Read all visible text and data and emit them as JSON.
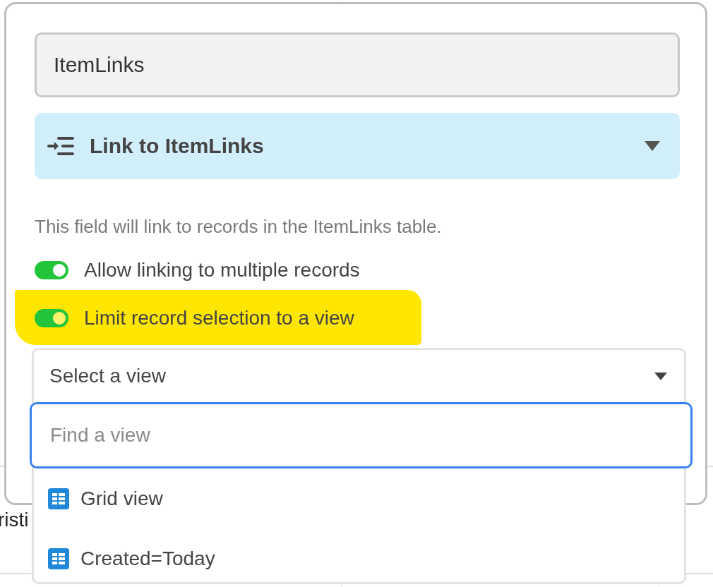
{
  "background_table": {
    "row_fragments": [
      {
        "text": "risti"
      }
    ]
  },
  "field_editor": {
    "name_field": {
      "value": "ItemLinks"
    },
    "field_type": {
      "label": "Link to ItemLinks"
    },
    "description": "This field will link to records in the ItemLinks table.",
    "options": [
      {
        "label": "Allow linking to multiple records",
        "on": true,
        "highlighted": false
      },
      {
        "label": "Limit record selection to a view",
        "on": true,
        "highlighted": true
      }
    ],
    "view_picker": {
      "value": "Select a view",
      "expanded": true,
      "search": {
        "placeholder": "Find a view"
      },
      "views": [
        {
          "label": "Grid view"
        },
        {
          "label": "Created=Today"
        }
      ]
    }
  }
}
